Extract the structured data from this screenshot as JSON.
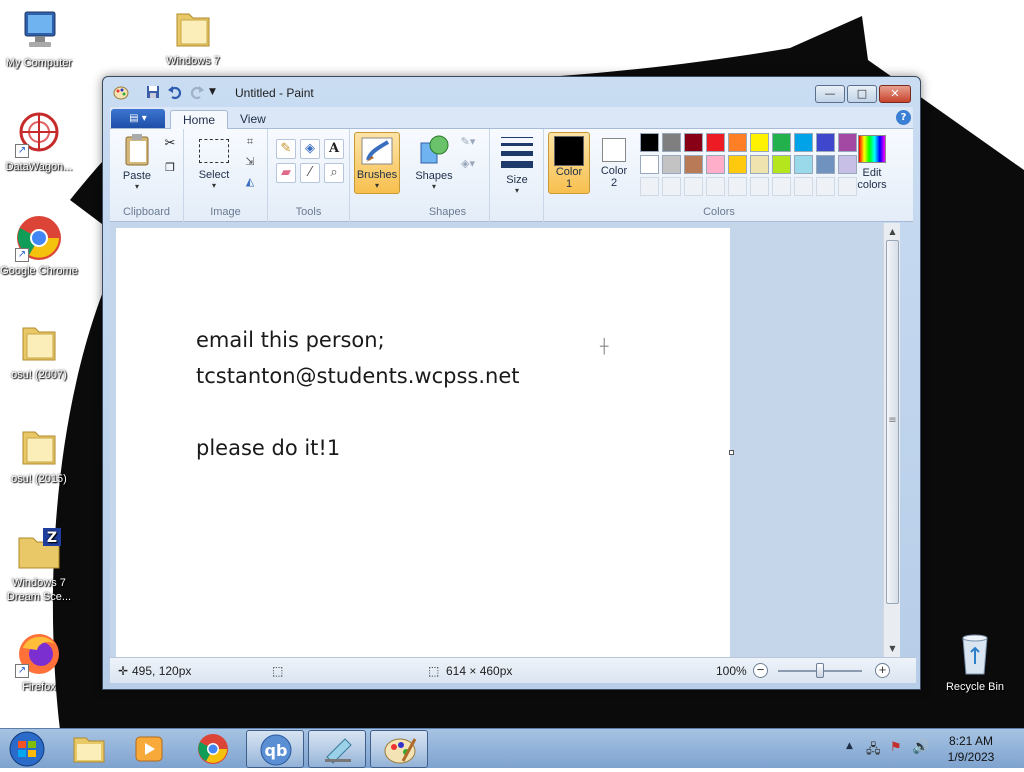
{
  "desktop": {
    "icons": [
      {
        "label": "My Computer"
      },
      {
        "label": "Windows 7"
      },
      {
        "label": "DataWagon..."
      },
      {
        "label": "Google Chrome"
      },
      {
        "label": "osu! (2007)"
      },
      {
        "label": "osu! (2015)"
      },
      {
        "label": "Windows 7 Dream Sce..."
      },
      {
        "label": "Firefox"
      },
      {
        "label": "Recycle Bin"
      }
    ]
  },
  "window": {
    "title": "Untitled - Paint",
    "controls": {
      "minimize": "—",
      "maximize": "□",
      "close": "✕"
    }
  },
  "tabs": {
    "home": "Home",
    "view": "View",
    "help": "?"
  },
  "ribbon": {
    "clipboard": {
      "paste": "Paste",
      "label": "Clipboard"
    },
    "image": {
      "select": "Select",
      "label": "Image"
    },
    "tools": {
      "label": "Tools",
      "text_tool": "A"
    },
    "brushes": {
      "label": "Brushes"
    },
    "shapes": {
      "button": "Shapes",
      "label": "Shapes"
    },
    "size": {
      "label": "Size"
    },
    "colors": {
      "color1_line1": "Color",
      "color1_line2": "1",
      "color2_line1": "Color",
      "color2_line2": "2",
      "edit_line1": "Edit",
      "edit_line2": "colors",
      "label": "Colors",
      "color1": "#000000",
      "color2": "#ffffff",
      "palette_row1": [
        "#000000",
        "#7f7f7f",
        "#880015",
        "#ed1c24",
        "#ff7f27",
        "#fff200",
        "#22b14c",
        "#00a2e8",
        "#3f48cc",
        "#a349a4"
      ],
      "palette_row2": [
        "#ffffff",
        "#c3c3c3",
        "#b97a57",
        "#ffaec9",
        "#ffc90e",
        "#efe4b0",
        "#b5e61d",
        "#99d9ea",
        "#7092be",
        "#c8bfe7"
      ]
    }
  },
  "canvas": {
    "lines": [
      "email this person;",
      "tcstanton@students.wcpss.net",
      "please do it!1"
    ]
  },
  "statusbar": {
    "cursor_pos": "495, 120px",
    "canvas_size": "614 × 460px",
    "zoom": "100%",
    "zoom_out": "−",
    "zoom_in": "+"
  },
  "taskbar": {
    "time": "8:21 AM",
    "date": "1/9/2023"
  }
}
